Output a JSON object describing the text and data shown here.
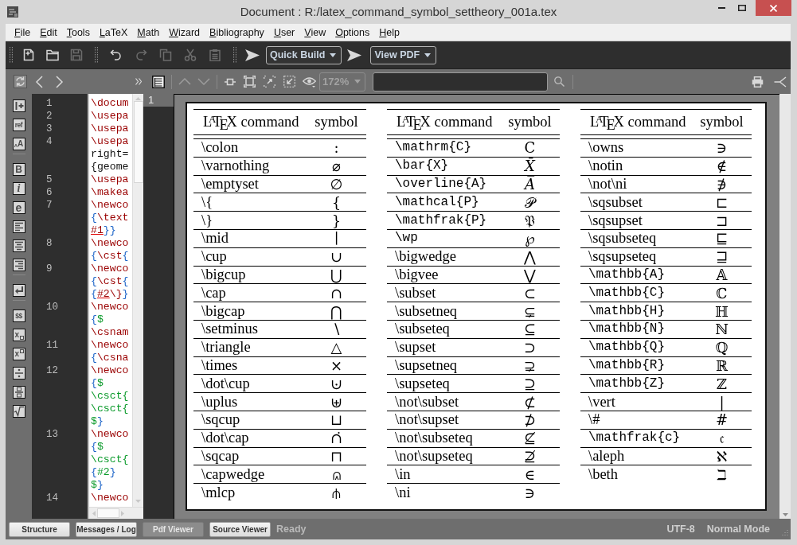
{
  "window": {
    "title": "Document : R:/latex_command_symbol_settheory_001a.tex"
  },
  "menu": [
    "File",
    "Edit",
    "Tools",
    "LaTeX",
    "Math",
    "Wizard",
    "Bibliography",
    "User",
    "View",
    "Options",
    "Help"
  ],
  "main_toolbar": [
    {
      "kind": "grip"
    },
    {
      "kind": "icon",
      "disabled": false
    },
    {
      "kind": "icon",
      "disabled": false
    },
    {
      "kind": "icon",
      "disabled": true
    },
    {
      "kind": "grip"
    },
    {
      "kind": "icon",
      "disabled": false
    },
    {
      "kind": "icon",
      "disabled": true
    },
    {
      "kind": "icon",
      "disabled": true
    },
    {
      "kind": "icon",
      "disabled": true
    },
    {
      "kind": "icon",
      "disabled": true
    },
    {
      "kind": "grip"
    },
    {
      "kind": "icon",
      "disabled": false
    },
    {
      "kind": "combo",
      "label": "Quick Build"
    },
    {
      "kind": "icon",
      "disabled": false
    },
    {
      "kind": "combo",
      "label": "View PDF"
    }
  ],
  "pdf_toolbar": {
    "nav": [
      {
        "disabled": false
      },
      {
        "disabled": false
      },
      {
        "disabled": false
      }
    ],
    "tools": [
      {
        "kind": "icon",
        "disabled": false
      },
      {
        "kind": "icon",
        "disabled": false
      },
      {
        "kind": "separator"
      },
      {
        "kind": "icon",
        "disabled": true
      },
      {
        "kind": "icon",
        "disabled": true
      },
      {
        "kind": "separator"
      },
      {
        "kind": "icon",
        "disabled": false
      },
      {
        "kind": "icon",
        "disabled": false
      },
      {
        "kind": "icon",
        "disabled": false
      },
      {
        "kind": "icon",
        "disabled": false
      },
      {
        "kind": "icon",
        "disabled": false
      }
    ],
    "zoom": {
      "value": "172%",
      "disabled": true
    },
    "actions": [
      {
        "disabled": false
      },
      {
        "disabled": false
      }
    ]
  },
  "sidebar_tools": [
    {
      "kind": "icon"
    },
    {
      "kind": "text",
      "label": "ref"
    },
    {
      "kind": "text",
      "label": "$_{A}$A"
    },
    {
      "kind": "separator"
    },
    {
      "kind": "text",
      "label": "B"
    },
    {
      "kind": "text",
      "label": "i"
    },
    {
      "kind": "text",
      "label": "e"
    },
    {
      "kind": "icon"
    },
    {
      "kind": "icon"
    },
    {
      "kind": "icon"
    },
    {
      "kind": "separator"
    },
    {
      "kind": "icon"
    },
    {
      "kind": "separator"
    },
    {
      "kind": "text",
      "label": "$$"
    },
    {
      "kind": "subscript",
      "label": "x"
    },
    {
      "kind": "superscript",
      "label": "x"
    },
    {
      "kind": "icon"
    },
    {
      "kind": "icon"
    },
    {
      "kind": "icon"
    }
  ],
  "editor": {
    "lines": [
      {
        "number": "1",
        "rows": [
          {
            "tokens": [
              {
                "text": "\\docum",
                "kind": "command"
              }
            ]
          }
        ]
      },
      {
        "number": "2",
        "rows": [
          {
            "tokens": [
              {
                "text": "\\usepa",
                "kind": "command"
              }
            ]
          }
        ]
      },
      {
        "number": "3",
        "rows": [
          {
            "tokens": [
              {
                "text": "\\usepa",
                "kind": "command"
              }
            ]
          }
        ]
      },
      {
        "number": "4",
        "rows": [
          {
            "tokens": [
              {
                "text": "\\usepa",
                "kind": "command"
              }
            ]
          },
          {
            "tokens": [
              {
                "text": "right=",
                "kind": "plain"
              }
            ]
          },
          {
            "tokens": [
              {
                "text": "{geome",
                "kind": "plain"
              }
            ]
          }
        ]
      },
      {
        "number": "5",
        "rows": [
          {
            "tokens": [
              {
                "text": "\\usepa",
                "kind": "command"
              }
            ]
          }
        ]
      },
      {
        "number": "6",
        "rows": [
          {
            "tokens": [
              {
                "text": "\\makea",
                "kind": "command"
              }
            ]
          }
        ]
      },
      {
        "number": "7",
        "rows": [
          {
            "tokens": [
              {
                "text": "\\newco",
                "kind": "command"
              }
            ]
          },
          {
            "tokens": [
              {
                "text": "{",
                "kind": "brace"
              },
              {
                "text": "\\text",
                "kind": "command"
              }
            ]
          },
          {
            "tokens": [
              {
                "text": "#1",
                "kind": "param"
              },
              {
                "text": "}}",
                "kind": "brace"
              }
            ]
          }
        ]
      },
      {
        "number": "8",
        "rows": [
          {
            "tokens": [
              {
                "text": "\\newco",
                "kind": "command"
              }
            ]
          },
          {
            "tokens": [
              {
                "text": "{",
                "kind": "brace"
              },
              {
                "text": "\\cst",
                "kind": "command"
              },
              {
                "text": "{",
                "kind": "brace"
              }
            ]
          }
        ]
      },
      {
        "number": "9",
        "rows": [
          {
            "tokens": [
              {
                "text": "\\newco",
                "kind": "command"
              }
            ]
          },
          {
            "tokens": [
              {
                "text": "{",
                "kind": "brace"
              },
              {
                "text": "\\cst",
                "kind": "command"
              },
              {
                "text": "{",
                "kind": "brace"
              }
            ]
          },
          {
            "tokens": [
              {
                "text": "{",
                "kind": "brace"
              },
              {
                "text": "#2",
                "kind": "param"
              },
              {
                "text": "\\}",
                "kind": "command"
              },
              {
                "text": "}",
                "kind": "brace"
              }
            ]
          }
        ]
      },
      {
        "number": "10",
        "rows": [
          {
            "tokens": [
              {
                "text": "\\newco",
                "kind": "command"
              }
            ]
          },
          {
            "tokens": [
              {
                "text": "{",
                "kind": "brace"
              },
              {
                "text": "$",
                "kind": "math"
              }
            ]
          },
          {
            "tokens": [
              {
                "text": "\\csnam",
                "kind": "command"
              }
            ]
          }
        ]
      },
      {
        "number": "11",
        "rows": [
          {
            "tokens": [
              {
                "text": "\\newco",
                "kind": "command"
              }
            ]
          },
          {
            "tokens": [
              {
                "text": "{",
                "kind": "brace"
              },
              {
                "text": "\\csna",
                "kind": "command"
              }
            ]
          }
        ]
      },
      {
        "number": "12",
        "rows": [
          {
            "tokens": [
              {
                "text": "\\newco",
                "kind": "command"
              }
            ]
          },
          {
            "tokens": [
              {
                "text": "{",
                "kind": "brace"
              },
              {
                "text": "$",
                "kind": "math"
              }
            ]
          },
          {
            "tokens": [
              {
                "text": "\\csct{",
                "kind": "math"
              }
            ]
          },
          {
            "tokens": [
              {
                "text": "\\csct{",
                "kind": "math"
              }
            ]
          },
          {
            "tokens": [
              {
                "text": "$",
                "kind": "math"
              },
              {
                "text": "}",
                "kind": "brace"
              }
            ]
          }
        ]
      },
      {
        "number": "13",
        "rows": [
          {
            "tokens": [
              {
                "text": "\\newco",
                "kind": "command"
              }
            ]
          },
          {
            "tokens": [
              {
                "text": "{",
                "kind": "brace"
              },
              {
                "text": "$",
                "kind": "math"
              }
            ]
          },
          {
            "tokens": [
              {
                "text": "\\csct{",
                "kind": "math"
              }
            ]
          },
          {
            "tokens": [
              {
                "text": "{",
                "kind": "brace"
              },
              {
                "text": "#2",
                "kind": "math"
              },
              {
                "text": "}",
                "kind": "brace"
              }
            ]
          },
          {
            "tokens": [
              {
                "text": "$",
                "kind": "math"
              },
              {
                "text": "}",
                "kind": "brace"
              }
            ]
          }
        ]
      },
      {
        "number": "14",
        "rows": [
          {
            "tokens": [
              {
                "text": "\\newco",
                "kind": "command"
              }
            ]
          }
        ]
      }
    ]
  },
  "pdf_viewer": {
    "page_label": "1",
    "tables": [
      {
        "columns": [
          "L$^{A}$T$_{E}$X command",
          "symbol"
        ],
        "rows": [
          {
            "command": "\\colon",
            "symbol": ":",
            "kind": "roman"
          },
          {
            "command": "\\varnothing",
            "symbol": "⌀",
            "kind": "roman"
          },
          {
            "command": "\\emptyset",
            "symbol": "∅",
            "kind": "roman"
          },
          {
            "command": "\\{",
            "symbol": "{",
            "kind": "roman"
          },
          {
            "command": "\\}",
            "symbol": "}",
            "kind": "roman"
          },
          {
            "command": "\\mid",
            "symbol": "∣",
            "kind": "roman"
          },
          {
            "command": "\\cup",
            "symbol": "∪",
            "kind": "roman"
          },
          {
            "command": "\\bigcup",
            "symbol": "⋃",
            "kind": "roman"
          },
          {
            "command": "\\cap",
            "symbol": "∩",
            "kind": "roman"
          },
          {
            "command": "\\bigcap",
            "symbol": "⋂",
            "kind": "roman"
          },
          {
            "command": "\\setminus",
            "symbol": "∖",
            "kind": "roman"
          },
          {
            "command": "\\triangle",
            "symbol": "△",
            "kind": "roman"
          },
          {
            "command": "\\times",
            "symbol": "×",
            "kind": "roman"
          },
          {
            "command": "\\dot\\cup",
            "symbol": "⊍",
            "kind": "roman"
          },
          {
            "command": "\\uplus",
            "symbol": "⊎",
            "kind": "roman"
          },
          {
            "command": "\\sqcup",
            "symbol": "⊔",
            "kind": "roman"
          },
          {
            "command": "\\dot\\cap",
            "symbol": "∩̇",
            "kind": "roman"
          },
          {
            "command": "\\sqcap",
            "symbol": "⊓",
            "kind": "roman"
          },
          {
            "command": "\\capwedge",
            "symbol": "⩄",
            "kind": "roman"
          },
          {
            "command": "\\mlcp",
            "symbol": "⫛",
            "kind": "roman"
          }
        ]
      },
      {
        "columns": [
          "L$^{A}$T$_{E}$X command",
          "symbol"
        ],
        "rows": [
          {
            "command": "\\mathrm{C}",
            "symbol": "C",
            "kind": "mono"
          },
          {
            "command": "\\bar{X}",
            "symbol": "𝑋̄",
            "kind": "mono"
          },
          {
            "command": "\\overline{A}",
            "symbol": "𝐴̅",
            "kind": "mono"
          },
          {
            "command": "\\mathcal{P}",
            "symbol": "𝒫",
            "kind": "mono"
          },
          {
            "command": "\\mathfrak{P}",
            "symbol": "𝔓",
            "kind": "mono"
          },
          {
            "command": "\\wp",
            "symbol": "℘",
            "kind": "mono"
          },
          {
            "command": "\\bigwedge",
            "symbol": "⋀",
            "kind": "roman"
          },
          {
            "command": "\\bigvee",
            "symbol": "⋁",
            "kind": "roman"
          },
          {
            "command": "\\subset",
            "symbol": "⊂",
            "kind": "roman"
          },
          {
            "command": "\\subsetneq",
            "symbol": "⊊",
            "kind": "roman"
          },
          {
            "command": "\\subseteq",
            "symbol": "⊆",
            "kind": "roman"
          },
          {
            "command": "\\supset",
            "symbol": "⊃",
            "kind": "roman"
          },
          {
            "command": "\\supsetneq",
            "symbol": "⊋",
            "kind": "roman"
          },
          {
            "command": "\\supseteq",
            "symbol": "⊇",
            "kind": "roman"
          },
          {
            "command": "\\not\\subset",
            "symbol": "⊄",
            "kind": "roman"
          },
          {
            "command": "\\not\\supset",
            "symbol": "⊅",
            "kind": "roman"
          },
          {
            "command": "\\not\\subseteq",
            "symbol": "⊈",
            "kind": "roman"
          },
          {
            "command": "\\not\\supseteq",
            "symbol": "⊉",
            "kind": "roman"
          },
          {
            "command": "\\in",
            "symbol": "∈",
            "kind": "roman"
          },
          {
            "command": "\\ni",
            "symbol": "∋",
            "kind": "roman"
          }
        ]
      },
      {
        "columns": [
          "L$^{A}$T$_{E}$X command",
          "symbol"
        ],
        "rows": [
          {
            "command": "\\owns",
            "symbol": "∋",
            "kind": "roman"
          },
          {
            "command": "\\notin",
            "symbol": "∉",
            "kind": "roman"
          },
          {
            "command": "\\not\\ni",
            "symbol": "∌",
            "kind": "roman"
          },
          {
            "command": "\\sqsubset",
            "symbol": "⊏",
            "kind": "roman"
          },
          {
            "command": "\\sqsupset",
            "symbol": "⊐",
            "kind": "roman"
          },
          {
            "command": "\\sqsubseteq",
            "symbol": "⊑",
            "kind": "roman"
          },
          {
            "command": "\\sqsupseteq",
            "symbol": "⊒",
            "kind": "roman"
          },
          {
            "command": "\\mathbb{A}",
            "symbol": "𝔸",
            "kind": "mono"
          },
          {
            "command": "\\mathbb{C}",
            "symbol": "ℂ",
            "kind": "mono"
          },
          {
            "command": "\\mathbb{H}",
            "symbol": "ℍ",
            "kind": "mono"
          },
          {
            "command": "\\mathbb{N}",
            "symbol": "ℕ",
            "kind": "mono"
          },
          {
            "command": "\\mathbb{Q}",
            "symbol": "ℚ",
            "kind": "mono"
          },
          {
            "command": "\\mathbb{R}",
            "symbol": "ℝ",
            "kind": "mono"
          },
          {
            "command": "\\mathbb{Z}",
            "symbol": "ℤ",
            "kind": "mono"
          },
          {
            "command": "\\vert",
            "symbol": "|",
            "kind": "roman"
          },
          {
            "command": "\\#",
            "symbol": "#",
            "kind": "roman"
          },
          {
            "command": "\\mathfrak{c}",
            "symbol": "𝔠",
            "kind": "mono"
          },
          {
            "command": "\\aleph",
            "symbol": "ℵ",
            "kind": "roman"
          },
          {
            "command": "\\beth",
            "symbol": "ℶ",
            "kind": "roman"
          }
        ]
      }
    ]
  },
  "status_bar": {
    "tabs": [
      {
        "label": "Structure",
        "selected": false
      },
      {
        "label": "Messages / Log",
        "selected": false
      },
      {
        "label": "Pdf Viewer",
        "selected": true
      },
      {
        "label": "Source Viewer",
        "selected": false
      }
    ],
    "message": "Ready",
    "encoding": "UTF-8",
    "mode": "Normal Mode"
  }
}
